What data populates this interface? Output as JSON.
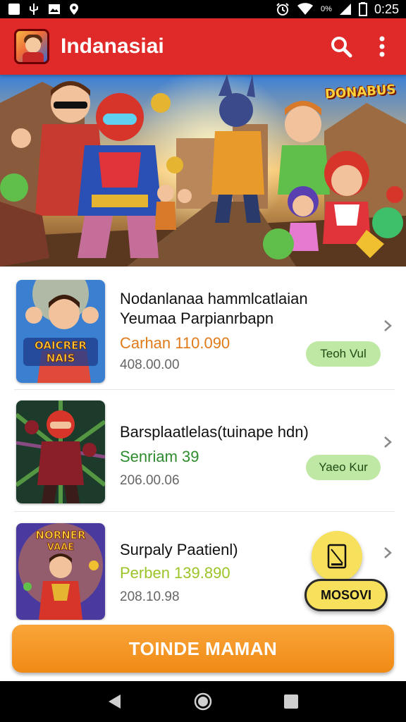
{
  "status_bar": {
    "battery_text": "0%",
    "time": "0:25",
    "left_icons": [
      "notification-icon",
      "usb-icon",
      "image-icon",
      "location-icon"
    ],
    "right_icons": [
      "alarm-icon",
      "wifi-icon",
      "signal-icon",
      "battery-icon"
    ]
  },
  "app_bar": {
    "title": "Indanasiai",
    "icons": [
      "app-logo-icon",
      "search-icon",
      "more-vert-icon"
    ],
    "background": "#e02a2a"
  },
  "banner": {
    "logo_text": "DONABUS"
  },
  "list": {
    "items": [
      {
        "title": "Nodanlanaa hammlcatlaian Yeumaa Parpianrbapn",
        "price": "Carhan 110.090",
        "price_color": "#e07b1a",
        "date": "408.00.00",
        "tag": "Teoh Vul",
        "thumb_text": "OAICRER NAIS"
      },
      {
        "title": "Barsplaatlelas(tuinape hdn)",
        "price": "Senriam 39",
        "price_color": "#2e8b2e",
        "date": "206.00.06",
        "tag": "Yaeo Kur",
        "thumb_text": ""
      },
      {
        "title": "Surpaly Paatienl)",
        "price": "Perben 139.890",
        "price_color": "#9cc428",
        "date": "208.10.98",
        "tag": "",
        "thumb_text": "NORNER VAAE"
      }
    ]
  },
  "fab": {
    "round_icon": "tablet-icon",
    "pill_label": "MOSOVI"
  },
  "cta": {
    "label": "TOINDE MAMAN",
    "color": "#f08a15"
  },
  "nav_bar": {
    "icons": [
      "back-icon",
      "home-icon",
      "recents-icon"
    ]
  }
}
